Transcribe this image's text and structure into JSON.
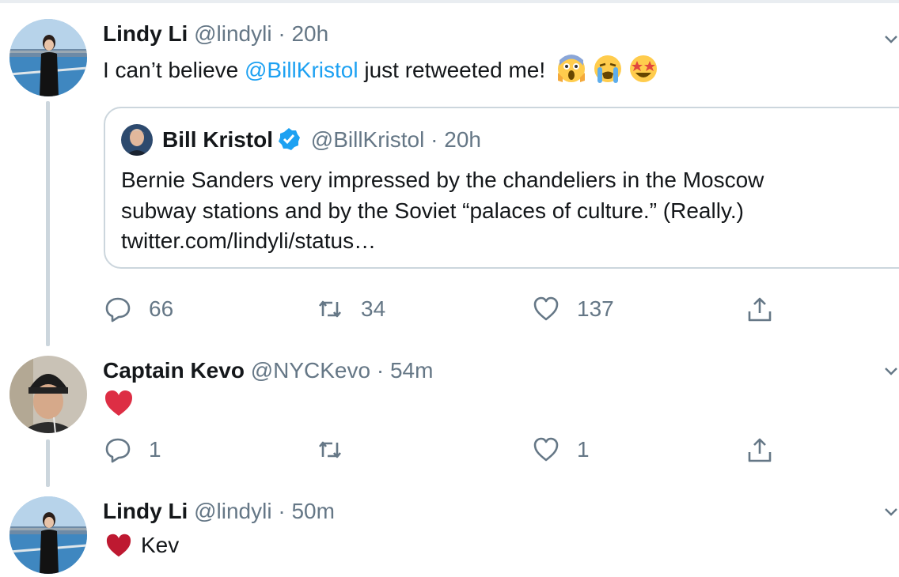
{
  "tweets": [
    {
      "name": "Lindy Li",
      "handle": "@lindyli",
      "time": "20h",
      "text_before": "I can’t believe ",
      "mention": "@BillKristol",
      "text_after": " just retweeted me!",
      "emojis": [
        "face-screaming-in-fear",
        "loudly-crying-face",
        "star-struck"
      ],
      "quote": {
        "name": "Bill Kristol",
        "handle": "@BillKristol",
        "time": "20h",
        "lines": [
          "Bernie Sanders very impressed by the chandeliers in the Moscow",
          "subway stations and by the Soviet “palaces of culture.” (Really.)",
          "twitter.com/lindyli/status…"
        ]
      },
      "actions": {
        "replies": "66",
        "retweets": "34",
        "likes": "137"
      }
    },
    {
      "name": "Captain Kevo",
      "handle": "@NYCKevo",
      "time": "54m",
      "emoji": "red-heart",
      "actions": {
        "replies": "1",
        "retweets": "",
        "likes": "1"
      }
    },
    {
      "name": "Lindy Li",
      "handle": "@lindyli",
      "time": "50m",
      "emoji": "red-heart",
      "text": "Kev"
    }
  ],
  "colors": {
    "link": "#1da1f2",
    "secondary_text": "#657786",
    "border": "#ccd6dd",
    "heart": "#e0245e"
  }
}
